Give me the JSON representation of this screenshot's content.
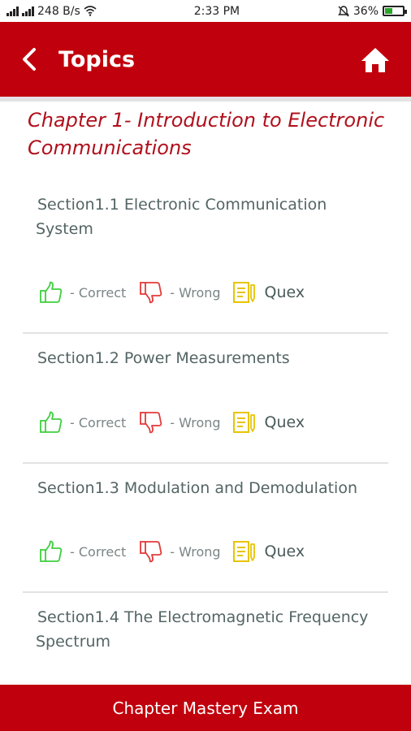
{
  "status_bar": {
    "network_speed": "248 B/s",
    "time": "2:33 PM",
    "battery": "36%"
  },
  "header": {
    "title": "Topics",
    "back_icon": "chevron-left-icon",
    "home_icon": "home-icon"
  },
  "chapter": {
    "title": "Chapter 1- Introduction to Electronic Communications"
  },
  "sections": [
    {
      "title": "Section1.1 Electronic Communication System",
      "correct_label": "- Correct",
      "wrong_label": "- Wrong",
      "quex_label": "Quex"
    },
    {
      "title": "Section1.2 Power Measurements",
      "correct_label": "- Correct",
      "wrong_label": "- Wrong",
      "quex_label": "Quex"
    },
    {
      "title": "Section1.3 Modulation and Demodulation",
      "correct_label": "- Correct",
      "wrong_label": "- Wrong",
      "quex_label": "Quex"
    },
    {
      "title": "Section1.4 The Electromagnetic Frequency Spectrum"
    }
  ],
  "footer": {
    "button_label": "Chapter Mastery Exam"
  },
  "colors": {
    "primary": "#c0000c",
    "correct": "#3ecf3e",
    "wrong": "#e23a3a",
    "quex": "#e8c400"
  }
}
